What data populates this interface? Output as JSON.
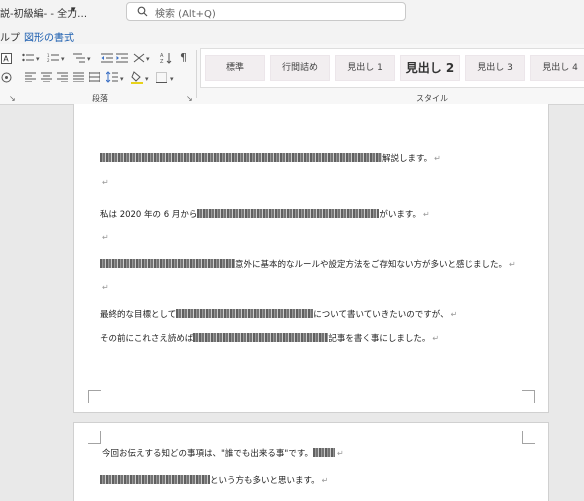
{
  "window": {
    "title": "説-初級編- - 全力…",
    "title_caret": "▾"
  },
  "search": {
    "text": "検索 (Alt+Q)"
  },
  "menu": {
    "help": "ルプ",
    "shape_format": "図形の書式"
  },
  "ribbon": {
    "paragraph_label": "段落",
    "styles_label": "スタイル",
    "styles": [
      "標準",
      "行間詰め",
      "見出し 1",
      "見出し 2",
      "見出し 3",
      "見出し 4"
    ]
  },
  "page1": {
    "line1": "解説します。",
    "line2_prefix": "私は 2020 年の 6 月から",
    "line2_suffix": "がいます。",
    "line3": "意外に基本的なルールや設定方法をご存知ない方が多いと感じました。",
    "line4_prefix": "最終的な目標として",
    "line4_suffix": "について書いていきたいのですが、",
    "line5_prefix": "その前にこれさえ読めば",
    "line5_suffix": "記事を書く事にしました。"
  },
  "page2": {
    "line1": "今回お伝えする知どの事項は、\"誰でも出来る事\"です。",
    "line2": "という方も多いと思います。"
  },
  "paragraph_mark": "↵"
}
